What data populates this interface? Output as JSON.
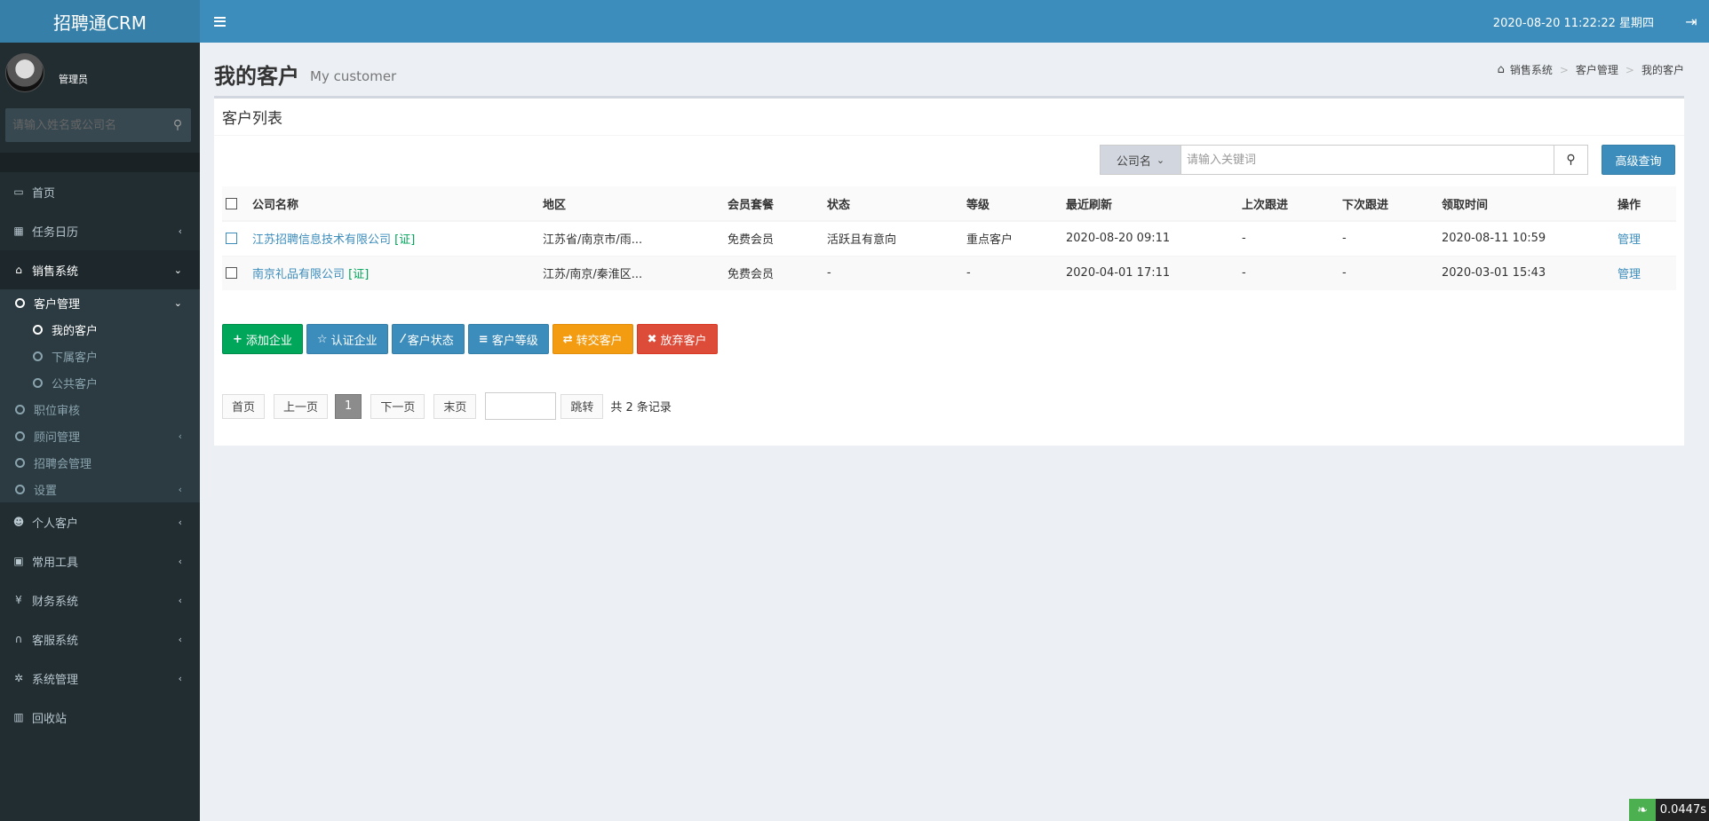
{
  "app": {
    "title": "招聘通CRM"
  },
  "topbar": {
    "datetime": "2020-08-20 11:22:22 星期四"
  },
  "sidebar": {
    "user": "管理员",
    "search_placeholder": "请输入姓名或公司名",
    "items": {
      "home": "首页",
      "calendar": "任务日历",
      "sales": "销售系统",
      "customer_mgmt": "客户管理",
      "my_customers": "我的客户",
      "sub_customers": "下属客户",
      "public_customers": "公共客户",
      "job_review": "职位审核",
      "consultant": "顾问管理",
      "job_fair": "招聘会管理",
      "settings": "设置",
      "personal": "个人客户",
      "tools": "常用工具",
      "finance": "财务系统",
      "service": "客服系统",
      "system": "系统管理",
      "recycle": "回收站"
    }
  },
  "header": {
    "title": "我的客户",
    "subtitle": "My customer",
    "breadcrumb": [
      "销售系统",
      "客户管理",
      "我的客户"
    ]
  },
  "box": {
    "title": "客户列表",
    "search": {
      "dropdown": "公司名",
      "placeholder": "请输入关键词",
      "advanced": "高级查询"
    }
  },
  "table": {
    "headers": [
      "公司名称",
      "地区",
      "会员套餐",
      "状态",
      "等级",
      "最近刷新",
      "上次跟进",
      "下次跟进",
      "领取时间",
      "操作"
    ],
    "rows": [
      {
        "company": "江苏招聘信息技术有限公司",
        "cert": "[证]",
        "region": "江苏省/南京市/雨...",
        "plan": "免费会员",
        "status": "活跃且有意向",
        "level": "重点客户",
        "refresh": "2020-08-20 09:11",
        "last": "-",
        "next": "-",
        "claimed": "2020-08-11 10:59",
        "action": "管理"
      },
      {
        "company": "南京礼品有限公司",
        "cert": "[证]",
        "region": "江苏/南京/秦淮区...",
        "plan": "免费会员",
        "status": "-",
        "level": "-",
        "refresh": "2020-04-01 17:11",
        "last": "-",
        "next": "-",
        "claimed": "2020-03-01 15:43",
        "action": "管理"
      }
    ]
  },
  "actions": [
    "添加企业",
    "认证企业",
    "客户状态",
    "客户等级",
    "转交客户",
    "放弃客户"
  ],
  "pager": {
    "first": "首页",
    "prev": "上一页",
    "current": "1",
    "next": "下一页",
    "last": "末页",
    "go": "跳转",
    "total": "共 2 条记录"
  },
  "corner": {
    "value": "0.0447s"
  }
}
